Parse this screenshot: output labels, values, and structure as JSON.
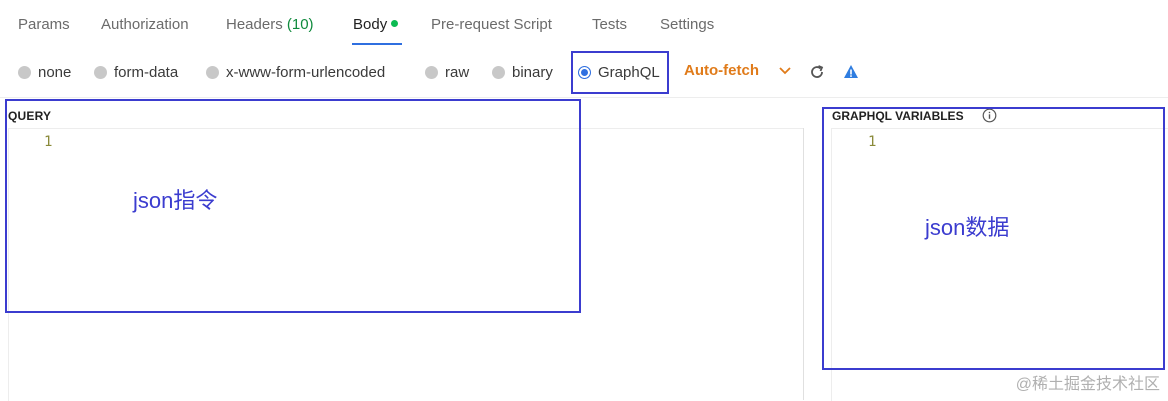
{
  "tabs": [
    {
      "label": "Params"
    },
    {
      "label": "Authorization"
    },
    {
      "label": "Headers",
      "count": "(10)"
    },
    {
      "label": "Body"
    },
    {
      "label": "Pre-request Script"
    },
    {
      "label": "Tests"
    },
    {
      "label": "Settings"
    }
  ],
  "active_tab": "Body",
  "body_modes": [
    {
      "label": "none",
      "checked": false
    },
    {
      "label": "form-data",
      "checked": false
    },
    {
      "label": "x-www-form-urlencoded",
      "checked": false
    },
    {
      "label": "raw",
      "checked": false
    },
    {
      "label": "binary",
      "checked": false
    },
    {
      "label": "GraphQL",
      "checked": true
    }
  ],
  "auto_fetch": "Auto-fetch",
  "query": {
    "header": "QUERY",
    "line_number": "1"
  },
  "variables": {
    "header": "GRAPHQL VARIABLES",
    "line_number": "1"
  },
  "annotations": {
    "query_note": "json指令",
    "variables_note": "json数据"
  },
  "watermark": "@稀土掘金技术社区",
  "colors": {
    "accent": "#2f6fe0",
    "annotation": "#3b3ccf",
    "auto_fetch": "#e07b1a",
    "count": "#0f8a3c"
  },
  "icons": [
    "chevron-down-icon",
    "refresh-icon",
    "warning-icon",
    "info-icon"
  ]
}
